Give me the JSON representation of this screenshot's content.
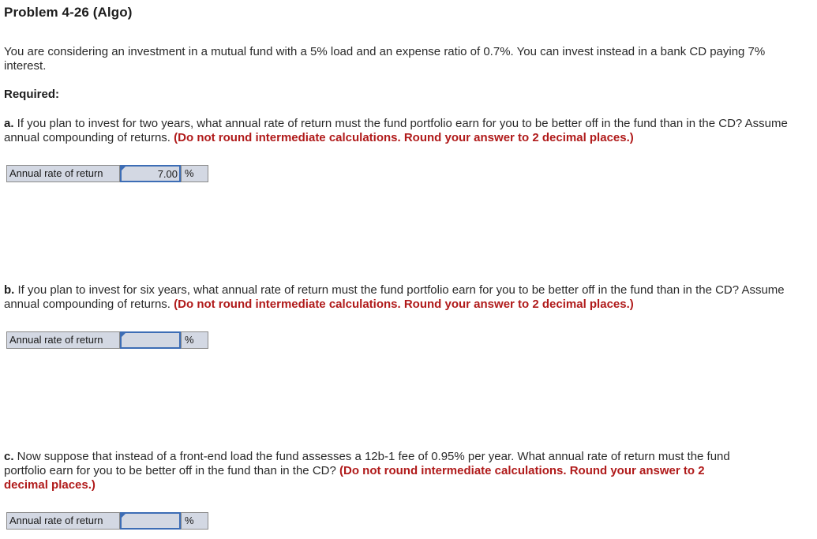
{
  "problem": {
    "title": "Problem 4-26 (Algo)",
    "intro": "You are considering an investment in a mutual fund with a 5% load and an expense ratio of 0.7%. You can invest instead in a bank CD paying 7% interest.",
    "required_label": "Required:"
  },
  "parts": [
    {
      "letter": "a.",
      "question": " If you plan to invest for two years, what annual rate of return must the fund portfolio earn for you to be better off in the fund than in the CD? Assume annual compounding of returns. ",
      "instruction": "(Do not round intermediate calculations. Round your answer to 2 decimal places.)",
      "answer": {
        "label": "Annual rate of return",
        "value": "7.00",
        "unit": "%"
      }
    },
    {
      "letter": "b.",
      "question": " If you plan to invest for six years, what annual rate of return must the fund portfolio earn for you to be better off in the fund than in the CD? Assume annual compounding of returns. ",
      "instruction": "(Do not round intermediate calculations. Round your answer to 2 decimal places.)",
      "answer": {
        "label": "Annual rate of return",
        "value": "",
        "unit": "%"
      }
    },
    {
      "letter": "c.",
      "question": " Now suppose that instead of a front-end load the fund assesses a 12b-1 fee of 0.95% per year. What annual rate of return must the fund portfolio earn for you to be better off in the fund than in the CD? ",
      "instruction": "(Do not round intermediate calculations. Round your answer to 2 decimal places.)",
      "answer": {
        "label": "Annual rate of return",
        "value": "",
        "unit": "%"
      }
    }
  ],
  "colors": {
    "instruction_red": "#b01a1a",
    "input_border_blue": "#3d6db5",
    "answer_row_bg": "#d3d8e3"
  }
}
